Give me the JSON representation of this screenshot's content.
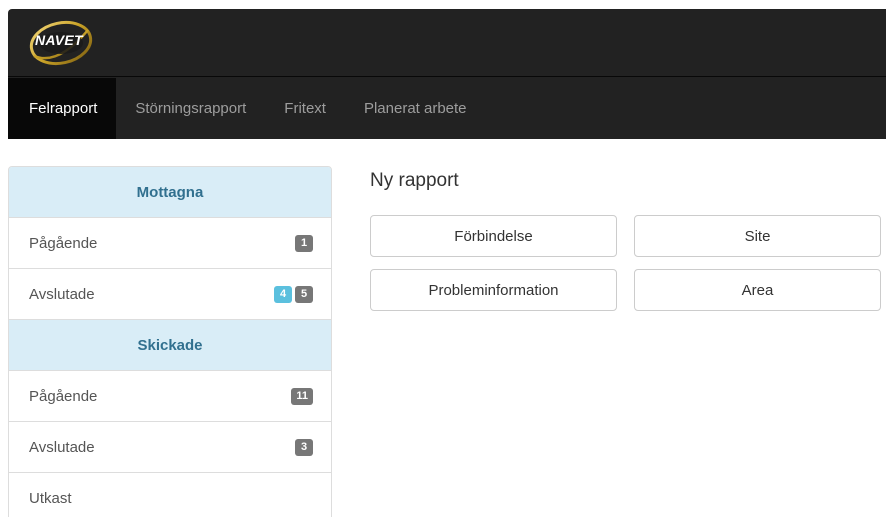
{
  "brand": {
    "logo_text": "NAVET"
  },
  "nav": {
    "items": [
      {
        "label": "Felrapport",
        "active": true
      },
      {
        "label": "Störningsrapport",
        "active": false
      },
      {
        "label": "Fritext",
        "active": false
      },
      {
        "label": "Planerat arbete",
        "active": false
      }
    ]
  },
  "sidebar": {
    "received": {
      "header": "Mottagna",
      "ongoing": {
        "label": "Pågående",
        "badges": [
          "1"
        ]
      },
      "finished": {
        "label": "Avslutade",
        "badges": [
          "4",
          "5"
        ]
      }
    },
    "sent": {
      "header": "Skickade",
      "ongoing": {
        "label": "Pågående",
        "badges": [
          "11"
        ]
      },
      "finished": {
        "label": "Avslutade",
        "badges": [
          "3"
        ]
      }
    },
    "draft": {
      "label": "Utkast"
    }
  },
  "main": {
    "heading": "Ny rapport",
    "buttons": [
      "Förbindelse",
      "Site",
      "Probleminformation",
      "Area"
    ]
  },
  "colors": {
    "navbar_bg": "#222222",
    "nav_active_bg": "#080808",
    "group_header_bg": "#d9edf7",
    "group_header_text": "#31708f",
    "badge_default": "#777777",
    "badge_info": "#5bc0de",
    "logo_gold": "#c9a227"
  }
}
